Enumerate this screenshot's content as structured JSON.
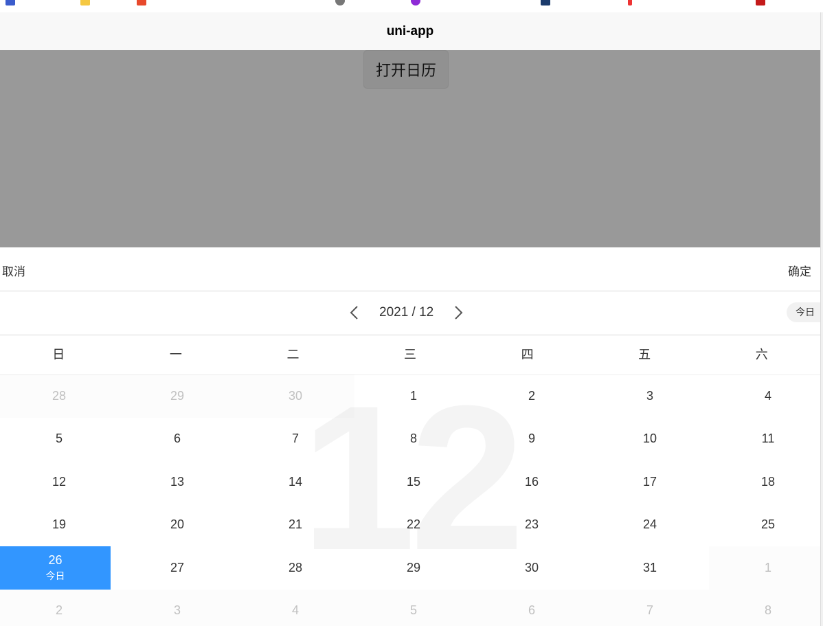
{
  "navbar": {
    "title": "uni-app"
  },
  "page": {
    "open_button": "打开日历"
  },
  "calendar": {
    "cancel": "取消",
    "confirm": "确定",
    "month_label": "2021 / 12",
    "today_button": "今日",
    "watermark": "12",
    "weekdays": [
      "日",
      "一",
      "二",
      "三",
      "四",
      "五",
      "六"
    ],
    "today_sub": "今日",
    "accent_color": "#3296ff",
    "rows": [
      [
        {
          "d": "28",
          "other": true
        },
        {
          "d": "29",
          "other": true
        },
        {
          "d": "30",
          "other": true
        },
        {
          "d": "1"
        },
        {
          "d": "2"
        },
        {
          "d": "3"
        },
        {
          "d": "4"
        }
      ],
      [
        {
          "d": "5"
        },
        {
          "d": "6"
        },
        {
          "d": "7"
        },
        {
          "d": "8"
        },
        {
          "d": "9"
        },
        {
          "d": "10"
        },
        {
          "d": "11"
        }
      ],
      [
        {
          "d": "12"
        },
        {
          "d": "13"
        },
        {
          "d": "14"
        },
        {
          "d": "15"
        },
        {
          "d": "16"
        },
        {
          "d": "17"
        },
        {
          "d": "18"
        }
      ],
      [
        {
          "d": "19"
        },
        {
          "d": "20"
        },
        {
          "d": "21"
        },
        {
          "d": "22"
        },
        {
          "d": "23"
        },
        {
          "d": "24"
        },
        {
          "d": "25"
        }
      ],
      [
        {
          "d": "26",
          "selected": true
        },
        {
          "d": "27"
        },
        {
          "d": "28"
        },
        {
          "d": "29"
        },
        {
          "d": "30"
        },
        {
          "d": "31"
        },
        {
          "d": "1",
          "other": true
        }
      ],
      [
        {
          "d": "2",
          "other": true
        },
        {
          "d": "3",
          "other": true
        },
        {
          "d": "4",
          "other": true
        },
        {
          "d": "5",
          "other": true
        },
        {
          "d": "6",
          "other": true
        },
        {
          "d": "7",
          "other": true
        },
        {
          "d": "8",
          "other": true
        }
      ]
    ]
  }
}
